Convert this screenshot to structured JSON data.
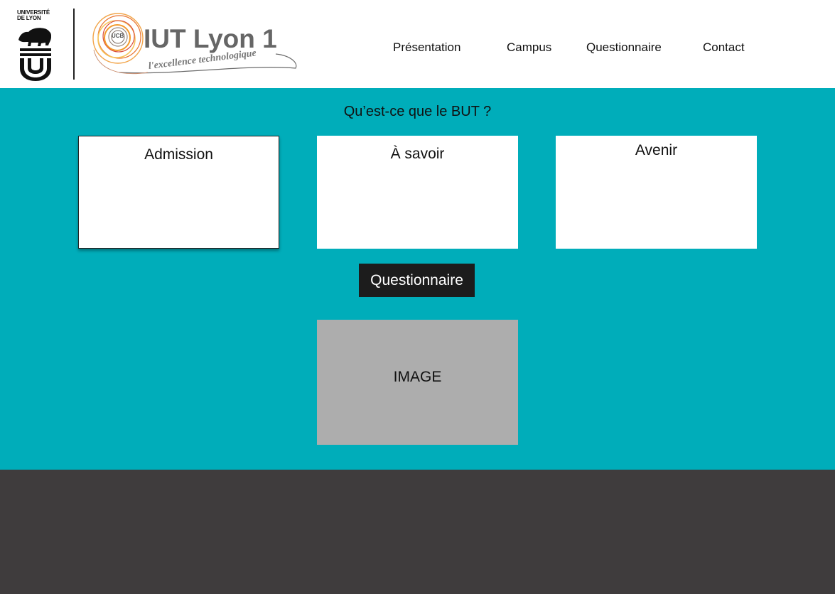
{
  "header": {
    "university_logo_lines": [
      "UNIVERSITÉ",
      "DE LYON"
    ],
    "iut_logo": {
      "title": "IUT Lyon 1",
      "tagline": "l'excellence technologique",
      "seal_text": "UCB"
    },
    "nav": [
      {
        "label": "Présentation"
      },
      {
        "label": "Campus"
      },
      {
        "label": "Questionnaire"
      },
      {
        "label": "Contact"
      }
    ]
  },
  "main": {
    "title": "Qu’est-ce que le BUT ?",
    "cards": [
      {
        "label": "Admission"
      },
      {
        "label": "À savoir"
      },
      {
        "label": "Avenir"
      }
    ],
    "button_label": "Questionnaire",
    "image_placeholder": "IMAGE"
  },
  "colors": {
    "header_bg": "#ffffff",
    "main_bg": "#00adba",
    "footer_bg": "#3f3c3d",
    "button_bg": "#1c1c1c",
    "image_bg": "#adadad"
  }
}
